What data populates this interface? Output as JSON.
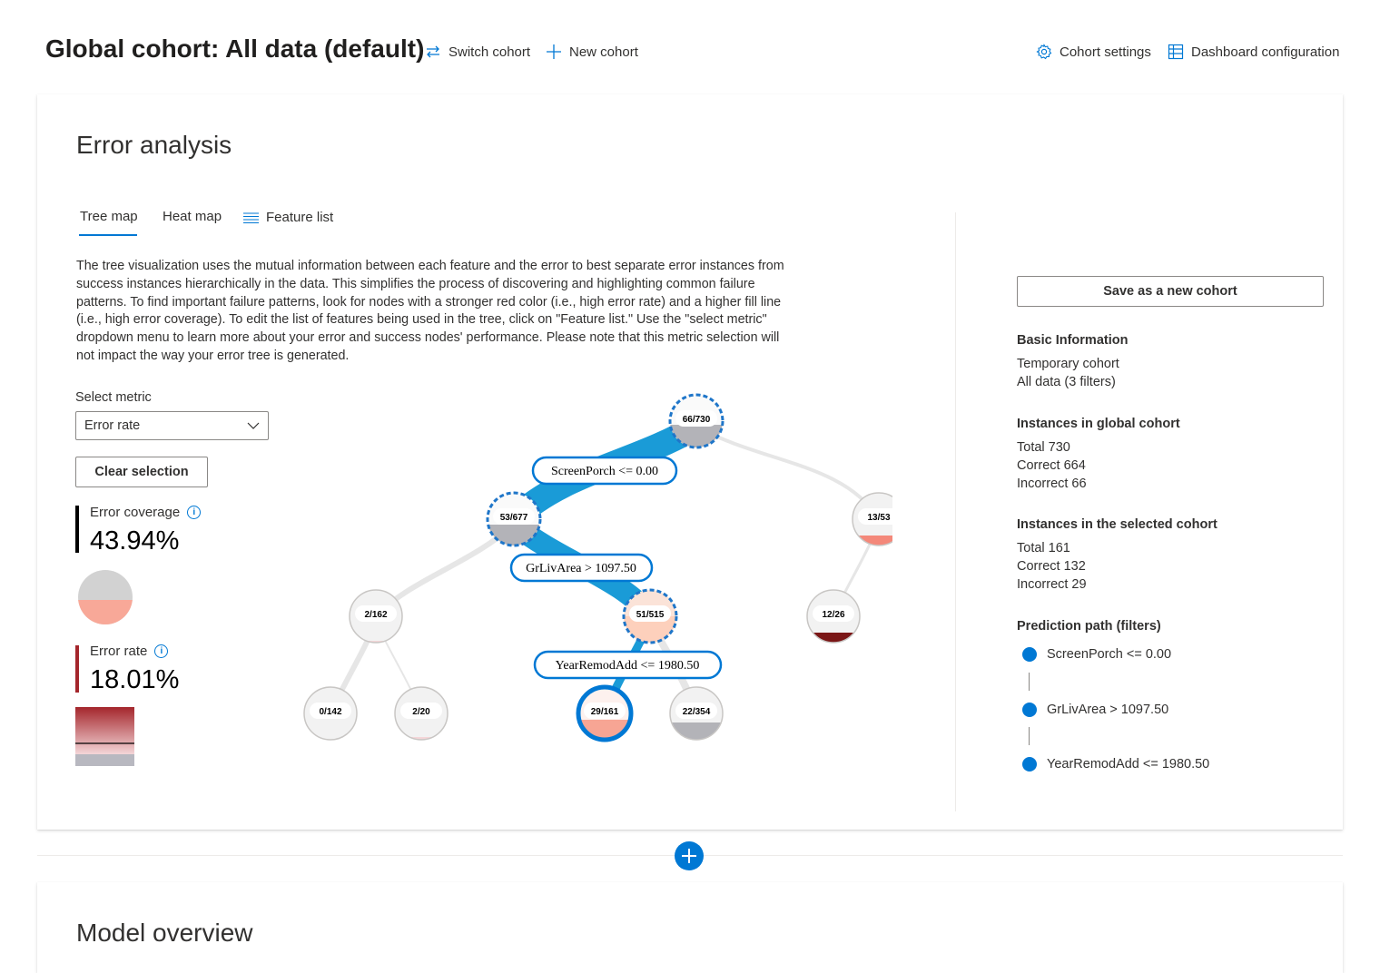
{
  "header": {
    "title": "Global cohort: All data (default)",
    "switch_cohort": "Switch cohort",
    "new_cohort": "New cohort",
    "cohort_settings": "Cohort settings",
    "dashboard_configuration": "Dashboard configuration"
  },
  "error_analysis": {
    "title": "Error analysis",
    "tabs": [
      {
        "label": "Tree map",
        "selected": true
      },
      {
        "label": "Heat map",
        "selected": false
      },
      {
        "label": "Feature list",
        "selected": false
      }
    ],
    "description": "The tree visualization uses the mutual information between each feature and the error to best separate error instances from success instances hierarchically in the data. This simplifies the process of discovering and highlighting common failure patterns. To find important failure patterns, look for nodes with a stronger red color (i.e., high error rate) and a higher fill line (i.e., high error coverage). To edit the list of features being used in the tree, click on \"Feature list.\" Use the \"select metric\" dropdown menu to learn more about your error and success nodes' performance. Please note that this metric selection will not impact the way your error tree is generated.",
    "select_metric_label": "Select metric",
    "select_metric_value": "Error rate",
    "clear_selection": "Clear selection",
    "error_coverage": {
      "label": "Error coverage",
      "value": "43.94%"
    },
    "error_rate": {
      "label": "Error rate",
      "value": "18.01%"
    }
  },
  "tree": {
    "nodes": [
      {
        "id": "n-root",
        "label": "66/730",
        "selected_path": true
      },
      {
        "id": "n-l",
        "label": "53/677",
        "selected_path": true
      },
      {
        "id": "n-r",
        "label": "13/53"
      },
      {
        "id": "n-ll",
        "label": "2/162"
      },
      {
        "id": "n-lr",
        "label": "51/515",
        "selected_path": true
      },
      {
        "id": "n-rl",
        "label": "12/26"
      },
      {
        "id": "n-lll",
        "label": "0/142"
      },
      {
        "id": "n-llr",
        "label": "2/20"
      },
      {
        "id": "n-lrl",
        "label": "29/161",
        "selected": true
      },
      {
        "id": "n-lrr",
        "label": "22/354"
      }
    ],
    "conditions": [
      "ScreenPorch <= 0.00",
      "GrLivArea > 1097.50",
      "YearRemodAdd <= 1980.50"
    ]
  },
  "side_panel": {
    "save_button": "Save as a new cohort",
    "basic_info": {
      "title": "Basic Information",
      "lines": [
        "Temporary cohort",
        "All data (3 filters)"
      ]
    },
    "global_cohort": {
      "title": "Instances in global cohort",
      "lines": [
        "Total 730",
        "Correct 664",
        "Incorrect 66"
      ]
    },
    "selected_cohort": {
      "title": "Instances in the selected cohort",
      "lines": [
        "Total 161",
        "Correct 132",
        "Incorrect 29"
      ]
    },
    "prediction_path": {
      "title": "Prediction path (filters)",
      "items": [
        "ScreenPorch <= 0.00",
        "GrLivArea > 1097.50",
        "YearRemodAdd <= 1980.50"
      ]
    }
  },
  "model_overview": {
    "title": "Model overview"
  },
  "colors": {
    "accent": "#0078d4",
    "error_red": "#a4262c",
    "coverage_black": "#000000"
  }
}
